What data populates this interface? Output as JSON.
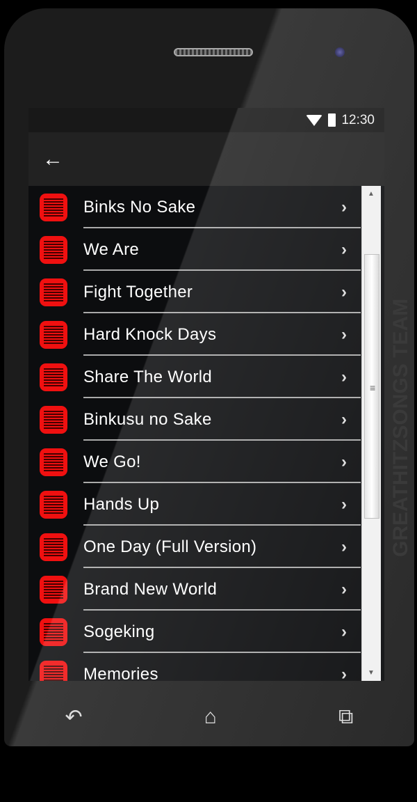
{
  "status_bar": {
    "time": "12:30",
    "icons": [
      "wifi-icon",
      "battery-icon"
    ]
  },
  "toolbar": {
    "back_icon": "arrow-left-icon"
  },
  "songs": [
    {
      "label": "Binks No Sake"
    },
    {
      "label": "We Are"
    },
    {
      "label": "Fight Together"
    },
    {
      "label": "Hard Knock Days"
    },
    {
      "label": "Share The World"
    },
    {
      "label": "Binkusu no Sake"
    },
    {
      "label": "We Go!"
    },
    {
      "label": "Hands Up"
    },
    {
      "label": "One Day (Full Version)"
    },
    {
      "label": "Brand New World"
    },
    {
      "label": "Sogeking"
    },
    {
      "label": "Memories"
    }
  ],
  "watermark": "GREATHITZSONGS TEAM",
  "nav": {
    "icons": [
      "back-icon",
      "home-icon",
      "recents-icon"
    ]
  },
  "colors": {
    "accent": "#f01010",
    "background": "#0c0d0f"
  }
}
